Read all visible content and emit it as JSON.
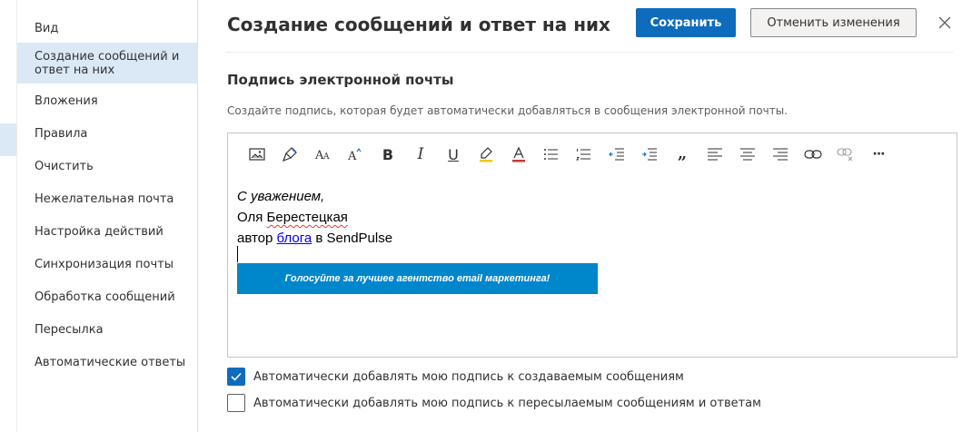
{
  "nav": {
    "items": [
      {
        "label": "Вид"
      },
      {
        "label": "Создание сообщений и ответ на них",
        "active": true
      },
      {
        "label": "Вложения"
      },
      {
        "label": "Правила"
      },
      {
        "label": "Очистить"
      },
      {
        "label": "Нежелательная почта"
      },
      {
        "label": "Настройка действий"
      },
      {
        "label": "Синхронизация почты"
      },
      {
        "label": "Обработка сообщений"
      },
      {
        "label": "Пересылка"
      },
      {
        "label": "Автоматические ответы"
      }
    ]
  },
  "header": {
    "title": "Создание сообщений и ответ на них",
    "save_label": "Сохранить",
    "cancel_label": "Отменить изменения",
    "close_icon": "close-icon"
  },
  "signature_section": {
    "title": "Подпись электронной почты",
    "description": "Создайте подпись, которая будет автоматически добавляться в сообщения электронной почты."
  },
  "toolbar": {
    "icons": [
      "insert-image-icon",
      "format-painter-icon",
      "font-size-icon",
      "font-size-increase-icon",
      "bold-icon",
      "italic-icon",
      "underline-icon",
      "highlight-icon",
      "font-color-icon",
      "bullets-icon",
      "numbering-icon",
      "decrease-indent-icon",
      "increase-indent-icon",
      "quote-icon",
      "align-left-icon",
      "align-center-icon",
      "align-right-icon",
      "insert-link-icon",
      "remove-link-icon",
      "more-options-icon"
    ],
    "bold_glyph": "B",
    "italic_glyph": "I",
    "underline_glyph": "U",
    "quote_glyph": "„",
    "more_glyph": "···"
  },
  "signature": {
    "line1": "С уважением,",
    "line2_first": "Оля ",
    "line2_last": "Берестецкая",
    "line3_prefix": "автор ",
    "line3_link": "блога",
    "line3_suffix": " в SendPulse",
    "banner_text": "Голосуйте за лучшее агентство email маркетинга!"
  },
  "options": {
    "auto_new": {
      "label": "Автоматически добавлять мою подпись к создаваемым сообщениям",
      "checked": true
    },
    "auto_reply": {
      "label": "Автоматически добавлять мою подпись к пересылаемым сообщениям и ответам",
      "checked": false
    }
  },
  "colors": {
    "accent": "#0f6cbd",
    "nav_selected": "#dbe9f7",
    "banner": "#0086cb"
  }
}
